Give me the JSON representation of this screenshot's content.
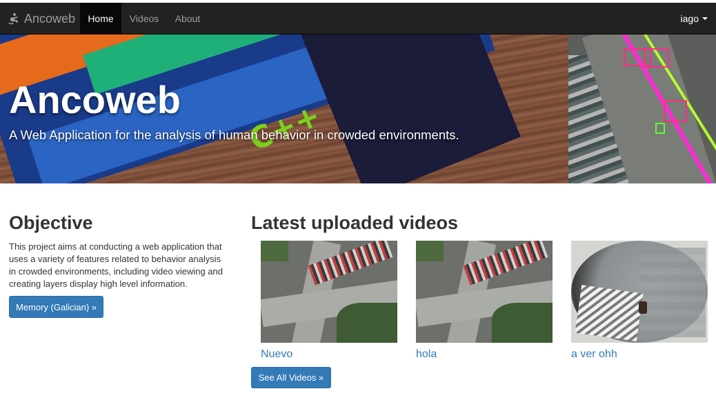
{
  "navbar": {
    "brand": "Ancoweb",
    "brand_icon": "accessibility-logo-icon",
    "items": [
      {
        "label": "Home",
        "active": true
      },
      {
        "label": "Videos",
        "active": false
      },
      {
        "label": "About",
        "active": false
      }
    ],
    "user": "iago"
  },
  "hero": {
    "title": "Ancoweb",
    "subtitle": "A Web Application for the analysis of human behavior in crowded environments."
  },
  "objective": {
    "title": "Objective",
    "text": "This project aims at conducting a web application that uses a variety of features related to behavior analysis in crowded environments, including video viewing and creating layers display high level information.",
    "button": "Memory (Galician) »"
  },
  "latest": {
    "title": "Latest uploaded videos",
    "videos": [
      {
        "title": "Nuevo"
      },
      {
        "title": "hola"
      },
      {
        "title": "a ver ohh"
      }
    ],
    "button": "See All Videos »"
  },
  "colors": {
    "navbar_bg": "#222222",
    "primary": "#337ab7",
    "link": "#337ab7"
  }
}
